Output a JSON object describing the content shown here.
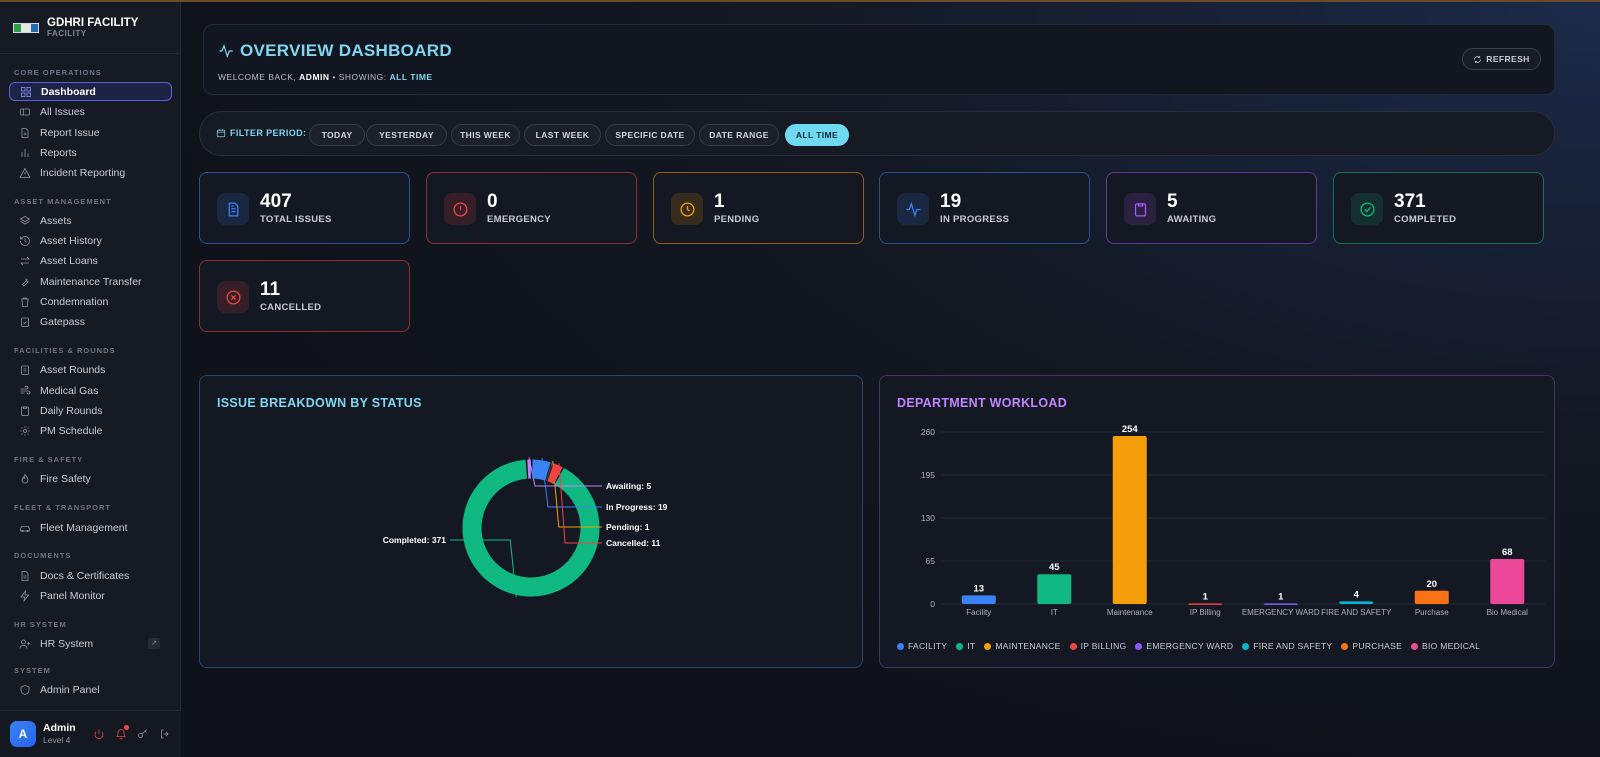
{
  "brand": {
    "name": "GDHRI FACILITY",
    "sub": "FACILITY"
  },
  "sidebar": {
    "sections": [
      {
        "title": "CORE OPERATIONS",
        "items": [
          {
            "label": "Dashboard",
            "icon": "grid-icon",
            "active": true
          },
          {
            "label": "All Issues",
            "icon": "ticket-icon"
          },
          {
            "label": "Report Issue",
            "icon": "file-plus-icon"
          },
          {
            "label": "Reports",
            "icon": "bar-chart-icon"
          },
          {
            "label": "Incident Reporting",
            "icon": "alert-triangle-icon"
          }
        ]
      },
      {
        "title": "ASSET MANAGEMENT",
        "items": [
          {
            "label": "Assets",
            "icon": "layers-icon"
          },
          {
            "label": "Asset History",
            "icon": "history-icon"
          },
          {
            "label": "Asset Loans",
            "icon": "arrows-exchange-icon"
          },
          {
            "label": "Maintenance Transfer",
            "icon": "wrench-icon"
          },
          {
            "label": "Condemnation",
            "icon": "trash-icon"
          },
          {
            "label": "Gatepass",
            "icon": "clipboard-check-icon"
          }
        ]
      },
      {
        "title": "FACILITIES & ROUNDS",
        "items": [
          {
            "label": "Asset Rounds",
            "icon": "clipboard-list-icon"
          },
          {
            "label": "Medical Gas",
            "icon": "wind-icon"
          },
          {
            "label": "Daily Rounds",
            "icon": "clipboard-icon"
          },
          {
            "label": "PM Schedule",
            "icon": "gear-icon"
          }
        ]
      },
      {
        "title": "FIRE & SAFETY",
        "items": [
          {
            "label": "Fire Safety",
            "icon": "flame-icon"
          }
        ]
      },
      {
        "title": "FLEET & TRANSPORT",
        "items": [
          {
            "label": "Fleet Management",
            "icon": "car-icon"
          }
        ]
      },
      {
        "title": "DOCUMENTS",
        "items": [
          {
            "label": "Docs & Certificates",
            "icon": "file-icon"
          },
          {
            "label": "Panel Monitor",
            "icon": "bolt-icon"
          }
        ]
      },
      {
        "title": "HR SYSTEM",
        "items": [
          {
            "label": "HR System",
            "icon": "user-plus-icon",
            "external": true
          }
        ]
      },
      {
        "title": "SYSTEM",
        "items": [
          {
            "label": "Admin Panel",
            "icon": "shield-icon"
          }
        ]
      }
    ]
  },
  "user": {
    "initial": "A",
    "name": "Admin",
    "level": "Level 4"
  },
  "header": {
    "title": "OVERVIEW DASHBOARD",
    "welcome_prefix": "WELCOME BACK,",
    "user": "ADMIN",
    "showing_prefix": "• SHOWING:",
    "period": "ALL TIME",
    "refresh_label": "REFRESH"
  },
  "filter": {
    "label": "FILTER PERIOD:",
    "options": [
      "TODAY",
      "YESTERDAY",
      "THIS WEEK",
      "LAST WEEK",
      "SPECIFIC DATE",
      "DATE RANGE",
      "ALL TIME"
    ],
    "selected": "ALL TIME"
  },
  "stats": [
    {
      "value": "407",
      "label": "TOTAL ISSUES",
      "color": "#3b82f6",
      "icon": "document-icon"
    },
    {
      "value": "0",
      "label": "EMERGENCY",
      "color": "#ef4444",
      "icon": "alert-circle-icon"
    },
    {
      "value": "1",
      "label": "PENDING",
      "color": "#f59e0b",
      "icon": "clock-icon"
    },
    {
      "value": "19",
      "label": "IN PROGRESS",
      "color": "#3b82f6",
      "icon": "activity-icon"
    },
    {
      "value": "5",
      "label": "AWAITING",
      "color": "#a855f7",
      "icon": "clipboard-icon"
    },
    {
      "value": "371",
      "label": "COMPLETED",
      "color": "#10b981",
      "icon": "check-circle-icon"
    },
    {
      "value": "11",
      "label": "CANCELLED",
      "color": "#ef4444",
      "icon": "x-circle-icon"
    }
  ],
  "status_panel": {
    "title": "ISSUE BREAKDOWN BY STATUS"
  },
  "workload_panel": {
    "title": "DEPARTMENT WORKLOAD"
  },
  "chart_data": [
    {
      "type": "pie",
      "title": "ISSUE BREAKDOWN BY STATUS",
      "donut": true,
      "slices": [
        {
          "label": "Completed",
          "value": 371,
          "color": "#10b981"
        },
        {
          "label": "Awaiting",
          "value": 5,
          "color": "#c084fc"
        },
        {
          "label": "In Progress",
          "value": 19,
          "color": "#3b82f6"
        },
        {
          "label": "Pending",
          "value": 1,
          "color": "#f59e0b"
        },
        {
          "label": "Cancelled",
          "value": 11,
          "color": "#ef4444"
        }
      ]
    },
    {
      "type": "bar",
      "title": "DEPARTMENT WORKLOAD",
      "categories": [
        "Facility",
        "IT",
        "Maintenance",
        "IP Billing",
        "EMERGENCY WARD",
        "FIRE AND SAFETY",
        "Purchase",
        "Bio Medical"
      ],
      "values": [
        13,
        45,
        254,
        1,
        1,
        4,
        20,
        68
      ],
      "colors": [
        "#3b82f6",
        "#10b981",
        "#f59e0b",
        "#ef4444",
        "#8b5cf6",
        "#06b6d4",
        "#f97316",
        "#ec4899"
      ],
      "legend": [
        "FACILITY",
        "IT",
        "MAINTENANCE",
        "IP BILLING",
        "EMERGENCY WARD",
        "FIRE AND SAFETY",
        "PURCHASE",
        "BIO MEDICAL"
      ],
      "yticks": [
        0,
        65,
        130,
        195,
        260
      ],
      "ylim": [
        0,
        260
      ],
      "grid": true,
      "legend_position": "bottom"
    }
  ]
}
